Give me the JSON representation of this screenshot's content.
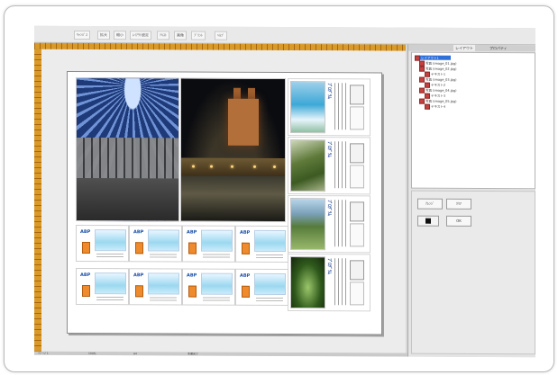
{
  "toolbar": {
    "items": [
      "ｷｬﾝﾊﾞｽ",
      "拡大",
      "縮小",
      "ﾚｲｱｳﾄ設定",
      "ﾃｷｽﾄ",
      "画像",
      "ﾌﾟﾘﾝﾄ",
      "ﾍﾙﾌﾟ"
    ]
  },
  "right_panel": {
    "tabs": [
      "レイアウト",
      "プロパティ"
    ],
    "tree": [
      {
        "label": "レイアウト1",
        "selected": true
      },
      {
        "label": "写真  (image_01.jpg)",
        "selected": false
      },
      {
        "label": "写真  (image_02.jpg)",
        "selected": false
      },
      {
        "label": "テキスト1",
        "selected": false
      },
      {
        "label": "写真  (image_03.jpg)",
        "selected": false
      },
      {
        "label": "テキスト2",
        "selected": false
      },
      {
        "label": "写真  (image_04.jpg)",
        "selected": false
      },
      {
        "label": "テキスト3",
        "selected": false
      },
      {
        "label": "写真  (image_05.jpg)",
        "selected": false
      },
      {
        "label": "テキスト4",
        "selected": false
      }
    ],
    "buttons": {
      "left": "ｱﾚﾝｼﾞ",
      "right": "ｸﾘｱ",
      "small": "OK"
    }
  },
  "flyer": {
    "brand": "ABP",
    "side_caption": "ﾌﾟﾛｸﾞﾗﾑ"
  },
  "status": [
    "ページ 1",
    "100%",
    "A4",
    "準備完了"
  ]
}
